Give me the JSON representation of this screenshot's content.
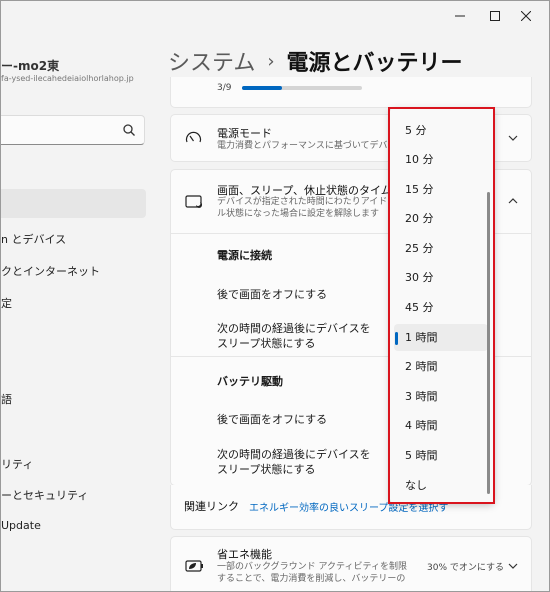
{
  "window_controls": {
    "minimize_icon": "minimize-icon",
    "maximize_icon": "maximize-icon",
    "close_icon": "close-icon"
  },
  "sidebar": {
    "user_name": "ー-mo2東",
    "user_email": "fa-ysed-ilecahedeiaiolhorlahop.jp",
    "search": {
      "value": "",
      "placeholder": "",
      "icon": "search-icon"
    },
    "items": [
      {
        "label": "n とデバイス"
      },
      {
        "label": "クとインターネット"
      },
      {
        "label": "定"
      },
      {
        "label": "語"
      },
      {
        "label": "リティ"
      },
      {
        "label": "ーとセキュリティ"
      },
      {
        "label": "Update"
      }
    ]
  },
  "header": {
    "parent": "システム",
    "separator": "›",
    "current": "電源とバッテリー"
  },
  "top_card": {
    "progress_text": "3/9",
    "progress_fraction": 0.33
  },
  "power_mode": {
    "title": "電源モード",
    "description": "電力消費とパフォーマンスに基づいてデバイスを最",
    "icon": "power-mode-icon"
  },
  "sleep_section": {
    "title": "画面、スリープ、休止状態のタイムアウト",
    "description": "デバイスが指定された時間にわたりアイドル状態になった場合に設定を解除します",
    "icon": "screen-sleep-icon",
    "plugged_in_heading": "電源に接続",
    "battery_heading": "バッテリ駆動",
    "screen_off_label": "後で画面をオフにする",
    "sleep_label": "次の時間の経過後にデバイスをスリープ状態にする"
  },
  "related": {
    "label": "関連リンク",
    "link": "エネルギー効率の良いスリープ設定を選択す"
  },
  "energy_saver": {
    "title": "省エネ機能",
    "description": "一部のバックグラウンド アクティビティを制限することで、電力消費を削減し、バッテリーの寿命を延長",
    "status": "30% でオンにする",
    "icon": "energy-saver-icon"
  },
  "dropdown": {
    "options": [
      "5 分",
      "10 分",
      "15 分",
      "20 分",
      "25 分",
      "30 分",
      "45 分",
      "1 時間",
      "2 時間",
      "3 時間",
      "4 時間",
      "5 時間",
      "なし"
    ],
    "selected": "1 時間"
  },
  "colors": {
    "accent": "#0067c0",
    "highlight": "#d9141e"
  }
}
